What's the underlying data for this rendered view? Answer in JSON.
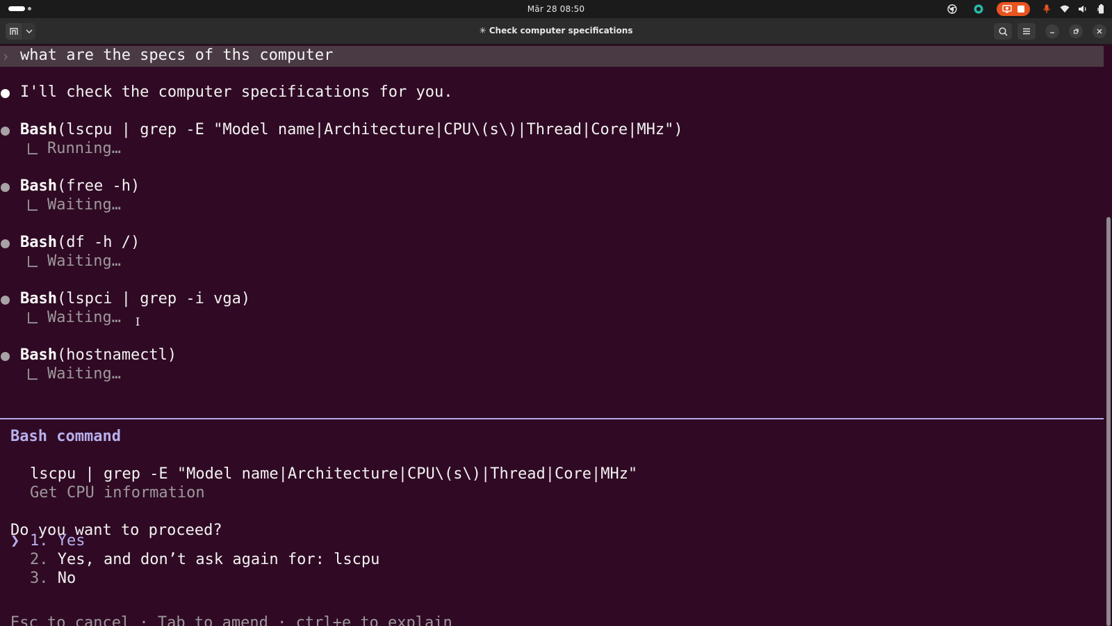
{
  "system_bar": {
    "datetime": "Mär 28  08:50",
    "icons": [
      "activities-indicator",
      "chrome-icon",
      "app-status-icon",
      "screen-record-icon",
      "stop-record-icon",
      "microphone-icon",
      "wifi-icon",
      "volume-icon",
      "battery-icon"
    ],
    "accent": "#e95420"
  },
  "window": {
    "title": "✳ Check computer specifications",
    "buttons": [
      "new-tab-icon",
      "tab-menu-chevron-icon",
      "search-icon",
      "hamburger-menu-icon",
      "minimize-icon",
      "maximize-icon",
      "close-icon"
    ]
  },
  "terminal": {
    "background": "#300a24",
    "prompt": "what are the specs of ths computer",
    "reply": "I'll check the computer specifications for you.",
    "tools": [
      {
        "name": "Bash",
        "args": "(lscpu | grep -E \"Model name|Architecture|CPU\\(s\\)|Thread|Core|MHz\")",
        "status": "Running…"
      },
      {
        "name": "Bash",
        "args": "(free -h)",
        "status": "Waiting…"
      },
      {
        "name": "Bash",
        "args": "(df -h /)",
        "status": "Waiting…"
      },
      {
        "name": "Bash",
        "args": "(lspci | grep -i vga)",
        "status": "Waiting…"
      },
      {
        "name": "Bash",
        "args": "(hostnamectl)",
        "status": "Waiting…"
      }
    ],
    "permission": {
      "title": "Bash command",
      "command": "lscpu | grep -E \"Model name|Architecture|CPU\\(s\\)|Thread|Core|MHz\"",
      "description": "Get CPU information",
      "question": "Do you want to proceed?",
      "cursor": "❯",
      "options": [
        {
          "num": "1.",
          "label": "Yes"
        },
        {
          "num": "2.",
          "label": "Yes, and don’t ask again for: lscpu"
        },
        {
          "num": "3.",
          "label": "No"
        }
      ],
      "selected_index": 0,
      "accent": "#b8b0ee",
      "footer_partial": "Esc to cancel · Tab to amend · ctrl+e to explain"
    }
  }
}
